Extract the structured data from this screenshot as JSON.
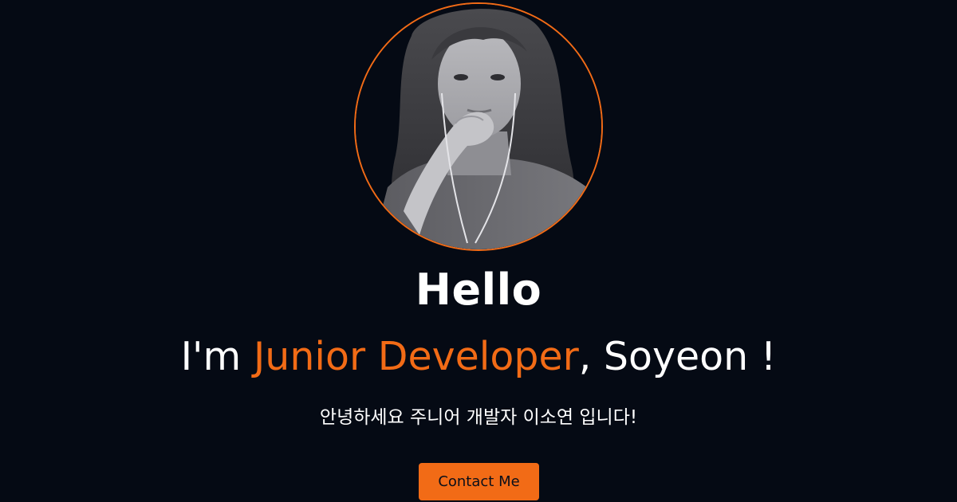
{
  "hero": {
    "hello": "Hello",
    "intro": {
      "prefix": "I'm ",
      "role": "Junior Developer",
      "suffix": ", Soyeon !"
    },
    "greeting_korean": "안녕하세요 주니어 개발자 이소연 입니다!",
    "contact_button_label": "Contact Me"
  },
  "colors": {
    "background": "#050a14",
    "accent": "#f26b16",
    "text": "#ffffff"
  }
}
